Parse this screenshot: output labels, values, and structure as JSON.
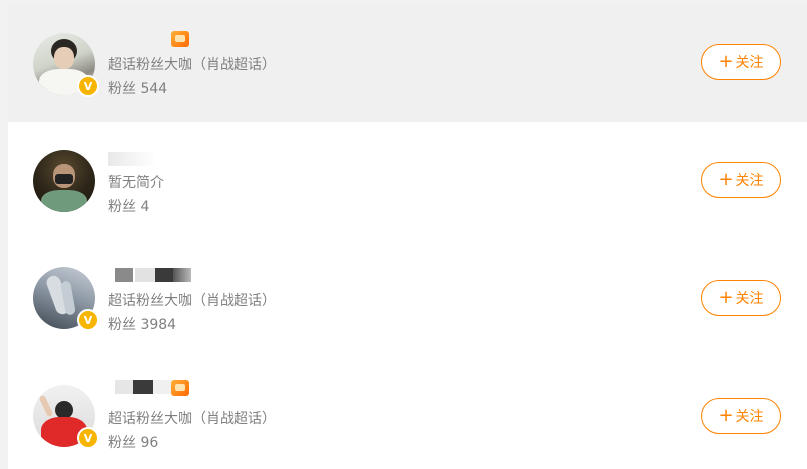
{
  "users": [
    {
      "description": "超话粉丝大咖（肖战超话）",
      "fans_label": "粉丝",
      "fans_count": "544",
      "follow_label": "关注",
      "follow_plus": "+",
      "verified_badge": "V"
    },
    {
      "description": "暂无简介",
      "fans_label": "粉丝",
      "fans_count": "4",
      "follow_label": "关注",
      "follow_plus": "+"
    },
    {
      "description": "超话粉丝大咖（肖战超话）",
      "fans_label": "粉丝",
      "fans_count": "3984",
      "follow_label": "关注",
      "follow_plus": "+",
      "verified_badge": "V"
    },
    {
      "description": "超话粉丝大咖（肖战超话）",
      "fans_label": "粉丝",
      "fans_count": "96",
      "follow_label": "关注",
      "follow_plus": "+",
      "verified_badge": "V"
    }
  ],
  "colors": {
    "accent": "#ff8200",
    "badge": "#f7b500",
    "text_secondary": "#808080"
  }
}
